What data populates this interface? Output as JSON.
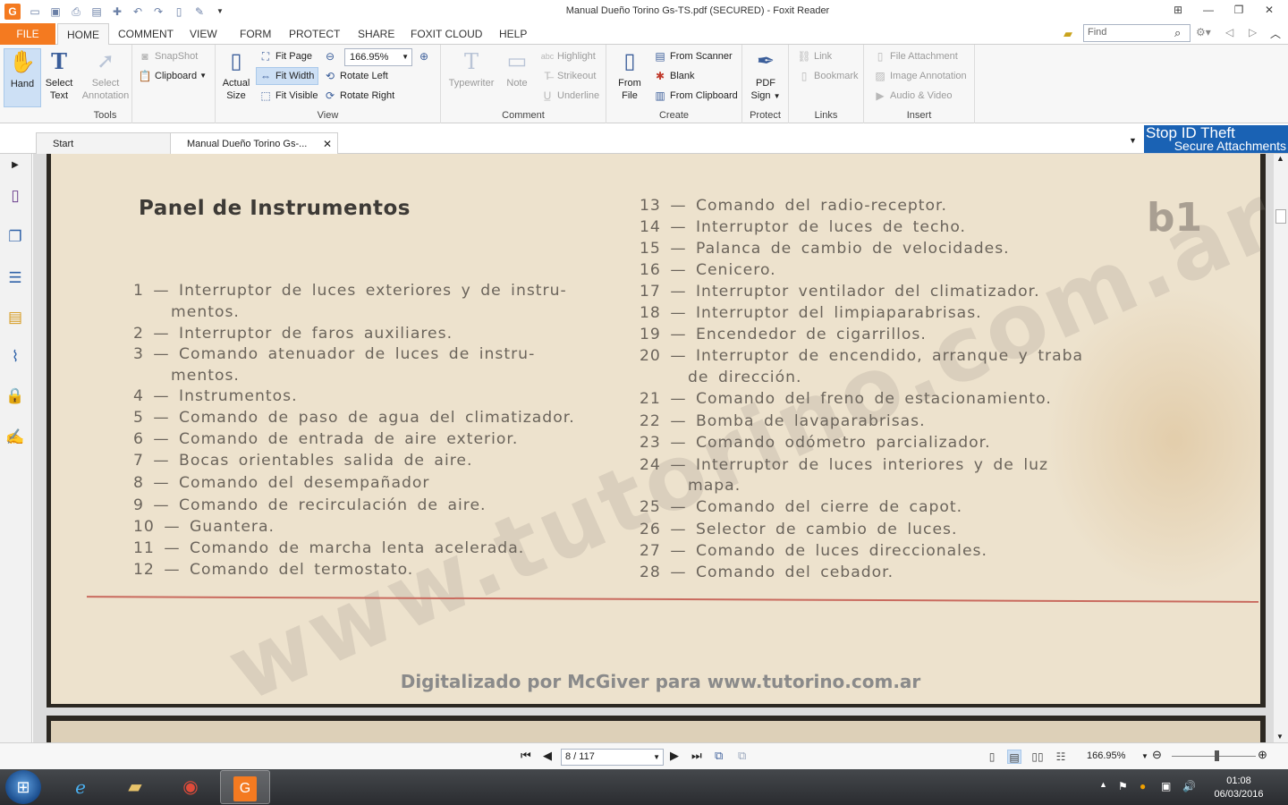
{
  "window": {
    "title": "Manual Dueño Torino Gs-TS.pdf (SECURED) - Foxit Reader",
    "quick_access_icons": [
      "open-folder-icon",
      "save-icon",
      "print-icon",
      "scan-icon",
      "bookmark-add-icon",
      "undo-icon",
      "redo-icon",
      "page-icon",
      "pen-icon",
      "customize-dropdown-icon"
    ],
    "controls": [
      "ribbon-toggle-icon",
      "minimize-icon",
      "restore-icon",
      "close-icon"
    ]
  },
  "menu": {
    "file": "FILE",
    "tabs": [
      "HOME",
      "COMMENT",
      "VIEW",
      "FORM",
      "PROTECT",
      "SHARE",
      "FOXIT CLOUD",
      "HELP"
    ],
    "active_tab": "HOME",
    "find_placeholder": "Find"
  },
  "ribbon": {
    "tools": {
      "label": "Tools",
      "hand": "Hand",
      "select_text_1": "Select",
      "select_text_2": "Text",
      "select_annotation_1": "Select",
      "select_annotation_2": "Annotation",
      "snapshot": "SnapShot",
      "clipboard": "Clipboard"
    },
    "view": {
      "label": "View",
      "actual_size_1": "Actual",
      "actual_size_2": "Size",
      "fit_page": "Fit Page",
      "fit_width": "Fit Width",
      "fit_visible": "Fit Visible",
      "zoom_value": "166.95%",
      "rotate_left": "Rotate Left",
      "rotate_right": "Rotate Right"
    },
    "comment": {
      "label": "Comment",
      "typewriter": "Typewriter",
      "note": "Note",
      "highlight": "Highlight",
      "strikeout": "Strikeout",
      "underline": "Underline"
    },
    "create": {
      "label": "Create",
      "from_file_1": "From",
      "from_file_2": "File",
      "from_scanner": "From Scanner",
      "blank": "Blank",
      "from_clipboard": "From Clipboard"
    },
    "protect": {
      "label": "Protect",
      "pdf_sign_1": "PDF",
      "pdf_sign_2": "Sign"
    },
    "links": {
      "label": "Links",
      "link": "Link",
      "bookmark": "Bookmark"
    },
    "insert": {
      "label": "Insert",
      "file_attachment": "File Attachment",
      "image_annotation": "Image Annotation",
      "audio_video": "Audio & Video"
    }
  },
  "doc_tabs": {
    "start": "Start",
    "active": "Manual Dueño Torino Gs-...",
    "close": "✕"
  },
  "ad": {
    "line1": "Stop ID Theft",
    "line2": "Secure Attachments"
  },
  "sidebar_icons": [
    "bookmarks-panel-icon",
    "pages-panel-icon",
    "layers-panel-icon",
    "comments-panel-icon",
    "attachments-panel-icon",
    "security-panel-icon",
    "signature-panel-icon"
  ],
  "page": {
    "title": "Panel de Instrumentos",
    "section": "b1",
    "left_items": [
      "1 — Interruptor de luces exteriores y de instru-",
      "mentos.",
      "2 — Interruptor de faros auxiliares.",
      "3 — Comando atenuador de luces de instru-",
      "mentos.",
      "4 — Instrumentos.",
      "5 — Comando de paso de agua del climatizador.",
      "6 — Comando de entrada de aire exterior.",
      "7 — Bocas orientables salida de aire.",
      "8 — Comando del desempañador",
      "9 — Comando de recirculación de aire.",
      "10 — Guantera.",
      "11 — Comando de marcha lenta acelerada.",
      "12 — Comando del termostato."
    ],
    "right_items": [
      "13 — Comando del radio-receptor.",
      "14 — Interruptor de luces de techo.",
      "15 — Palanca de cambio de velocidades.",
      "16 — Cenicero.",
      "17 — Interruptor ventilador del climatizador.",
      "18 — Interruptor del limpiaparabrisas.",
      "19 — Encendedor de cigarrillos.",
      "20 — Interruptor de encendido, arranque y traba",
      "de dirección.",
      "21 — Comando del freno de estacionamiento.",
      "22 — Bomba de lavaparabrisas.",
      "23 — Comando odómetro parcializador.",
      "24 — Interruptor de luces interiores y de luz",
      "mapa.",
      "25 — Comando del cierre de capot.",
      "26 — Selector de cambio de luces.",
      "27 — Comando de luces direccionales.",
      "28 — Comando del cebador."
    ],
    "watermark": "www.tutorino.com.ar",
    "credit": "Digitalizado por McGiver para www.tutorino.com.ar"
  },
  "status": {
    "page_display": "8 / 117",
    "zoom": "166.95%"
  },
  "taskbar": {
    "apps": [
      "internet-explorer-icon",
      "file-explorer-icon",
      "chrome-icon",
      "foxit-reader-icon"
    ],
    "time": "01:08",
    "date": "06/03/2016"
  },
  "colors": {
    "accent": "#f47a20",
    "ad_blue": "#1a62b4",
    "selection": "#cde0f5",
    "paper": "#ede2cd"
  }
}
